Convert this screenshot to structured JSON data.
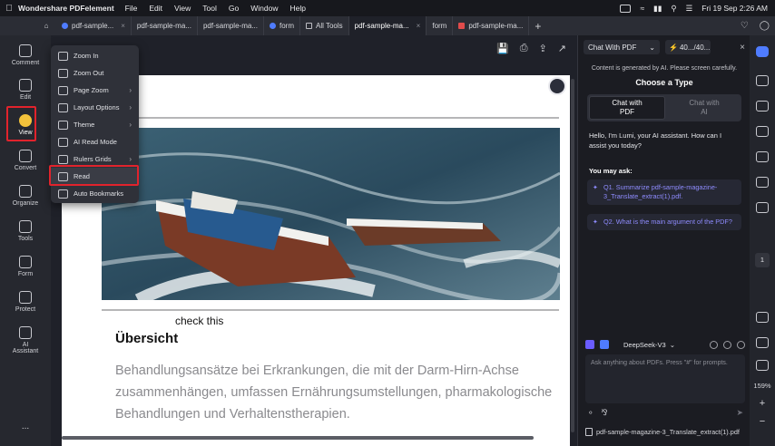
{
  "menubar": {
    "app_name": "Wondershare PDFelement",
    "menus": [
      "File",
      "Edit",
      "View",
      "Tool",
      "Go",
      "Window",
      "Help"
    ],
    "datetime": "Fri 19 Sep  2:26 AM"
  },
  "tabs": [
    {
      "label": "pdf-sample...",
      "icon": "doc-icon"
    },
    {
      "label": "pdf-sample-ma...",
      "icon": "none"
    },
    {
      "label": "pdf-sample-ma...",
      "icon": "none"
    },
    {
      "label": "form",
      "icon": "doc-icon"
    },
    {
      "label": "All Tools",
      "icon": "grid-icon"
    },
    {
      "label": "pdf-sample-ma...",
      "icon": "none",
      "active": true
    },
    {
      "label": "form",
      "icon": "none"
    },
    {
      "label": "pdf-sample-ma...",
      "icon": "pdf-icon"
    }
  ],
  "sidebar": {
    "items": [
      {
        "label": "Comment",
        "icon": "comment-icon"
      },
      {
        "label": "Edit",
        "icon": "edit-icon"
      },
      {
        "label": "View",
        "icon": "view-icon",
        "active": true
      },
      {
        "label": "Convert",
        "icon": "convert-icon"
      },
      {
        "label": "Organize",
        "icon": "organize-icon"
      },
      {
        "label": "Tools",
        "icon": "tools-icon"
      },
      {
        "label": "Form",
        "icon": "form-icon"
      },
      {
        "label": "Protect",
        "icon": "protect-icon"
      },
      {
        "label": "AI\nAssistant",
        "icon": "ai-assistant-icon"
      }
    ],
    "more": "..."
  },
  "view_menu": {
    "items": [
      {
        "label": "Zoom In",
        "icon": "zoom-in-icon",
        "submenu": false
      },
      {
        "label": "Zoom Out",
        "icon": "zoom-out-icon",
        "submenu": false
      },
      {
        "label": "Page Zoom",
        "icon": "page-zoom-icon",
        "submenu": true
      },
      {
        "label": "Layout Options",
        "icon": "layout-icon",
        "submenu": true
      },
      {
        "label": "Theme",
        "icon": "theme-icon",
        "submenu": true
      },
      {
        "label": "AI Read Mode",
        "icon": "ai-read-icon",
        "submenu": false
      },
      {
        "label": "Rulers Grids",
        "icon": "ruler-icon",
        "submenu": true
      },
      {
        "label": "Read",
        "icon": "read-icon",
        "submenu": false,
        "highlight": true
      },
      {
        "label": "Auto Bookmarks",
        "icon": "bookmark-icon",
        "submenu": false
      }
    ]
  },
  "document": {
    "caption": "check this",
    "heading": "Übersicht",
    "body": "Behandlungsansätze bei Erkrankungen, die mit der Darm-Hirn-Achse zusammenhängen, umfassen Ernährungsumstellungen, pharmakologische Behandlungen und Verhaltenstherapien."
  },
  "ai_panel": {
    "mode_select": "Chat With PDF",
    "token_count": "40.../40...",
    "disclaimer": "Content is generated by AI. Please screen carefully.",
    "choose_title": "Choose a Type",
    "type_options": [
      "Chat with\nPDF",
      "Chat with\nAI"
    ],
    "greeting": "Hello, I'm Lumi, your AI assistant. How can I assist you today?",
    "may_ask": "You may ask:",
    "questions": [
      "Q1. Summarize pdf-sample-magazine-3_Translate_extract(1).pdf.",
      "Q2. What is the main argument of the PDF?"
    ],
    "model": "DeepSeek-V3",
    "input_placeholder": "Ask anything about PDFs. Press \"#\" for prompts.",
    "file_name": "pdf-sample-magazine-3_Translate_extract(1).pdf"
  },
  "rail": {
    "page_number": "1",
    "zoom": "159%"
  },
  "colors": {
    "accent": "#4f7cff",
    "highlight_box": "#e1232c",
    "question_text": "#8f8cff"
  }
}
